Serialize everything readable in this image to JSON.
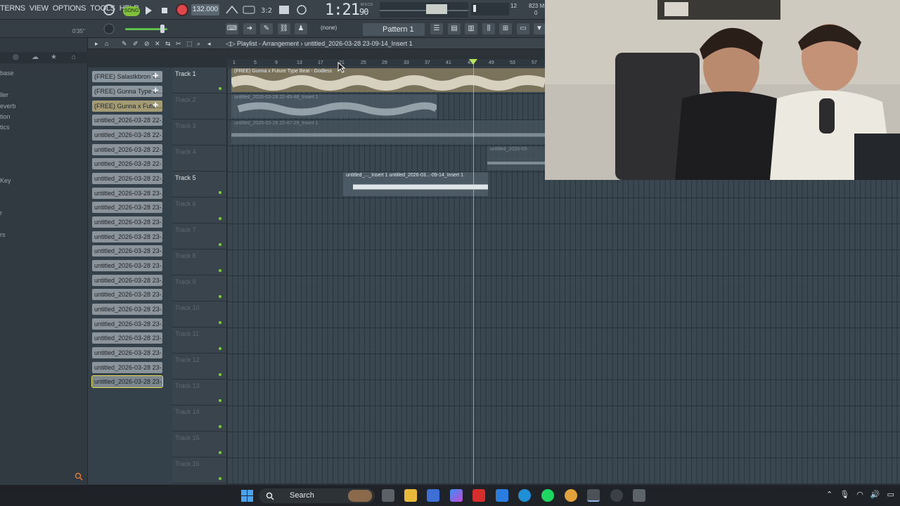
{
  "menu": [
    "TERNS",
    "VIEW",
    "OPTIONS",
    "TOOLS",
    "HELP"
  ],
  "transport": {
    "song_label": "SONG",
    "tempo": "132.000",
    "time": "1:21",
    "time_sub": "90",
    "time_unit": "M:S:CS",
    "cpu_a": "12",
    "cpu_b": "823 M",
    "cpu_c": "0"
  },
  "toolbar2": {
    "elapsed": "0'35\"",
    "none_select": "(none)",
    "pattern_select": "Pattern 1"
  },
  "playlist": {
    "title": "Playlist - Arrangement",
    "breadcrumb": "untitled_2026-03-28 23-09-14_Insert 1",
    "ruler": [
      "1",
      "5",
      "9",
      "13",
      "17",
      "21",
      "25",
      "29",
      "33",
      "37",
      "41",
      "45",
      "49",
      "53",
      "57"
    ]
  },
  "browser": {
    "items": [
      "base",
      "ller",
      "everb",
      "tion",
      "tics",
      "Key",
      "r",
      "rs"
    ]
  },
  "clips": [
    "(FREE) Salastkbron T...",
    "(FREE) Gunna Type B...",
    "(FREE) Gunna x Futur...",
    "untitled_2026-03-28 22-...",
    "untitled_2026-03-28 22-...",
    "untitled_2026-03-28 22-...",
    "untitled_2026-03-28 22-...",
    "untitled_2026-03-28 22-...",
    "untitled_2026-03-28 23-...",
    "untitled_2026-03-28 23-...",
    "untitled_2026-03-28 23-...",
    "untitled_2026-03-28 23-...",
    "untitled_2026-03-28 23-...",
    "untitled_2026-03-28 23-...",
    "untitled_2026-03-28 23-...",
    "untitled_2026-03-28 23-...",
    "untitled_2026-03-28 23-...",
    "untitled_2026-03-28 23-...",
    "untitled_2026-03-28 23-...",
    "untitled_2026-03-28 23-...",
    "untitled_2026-03-28 23-...",
    "untitled_2026-03-28 23-..."
  ],
  "tracks": [
    "Track 1",
    "Track 2",
    "Track 3",
    "Track 4",
    "Track 5",
    "Track 6",
    "Track 7",
    "Track 8",
    "Track 9",
    "Track 10",
    "Track 11",
    "Track 12",
    "Track 13",
    "Track 14",
    "Track 15",
    "Track 16"
  ],
  "arrangement": {
    "clip1": "(FREE) Gunna x Future Type Beat - Godless",
    "clip2": "untitled_2026-03-28 22-45-48_Insert 1",
    "clip3": "untitled_2026-03-28 22-47-29_Insert 1",
    "clip4": "untitled_2026-03-",
    "clip5a": "untitled_..._Insert 1",
    "clip5b": "untitled_2026-03...-09-14_Insert 1"
  },
  "taskbar": {
    "search": "Search"
  },
  "colors": {
    "accent_green": "#7fbf3b",
    "record_red": "#e0474c",
    "playlist_bg": "#3a4750"
  }
}
